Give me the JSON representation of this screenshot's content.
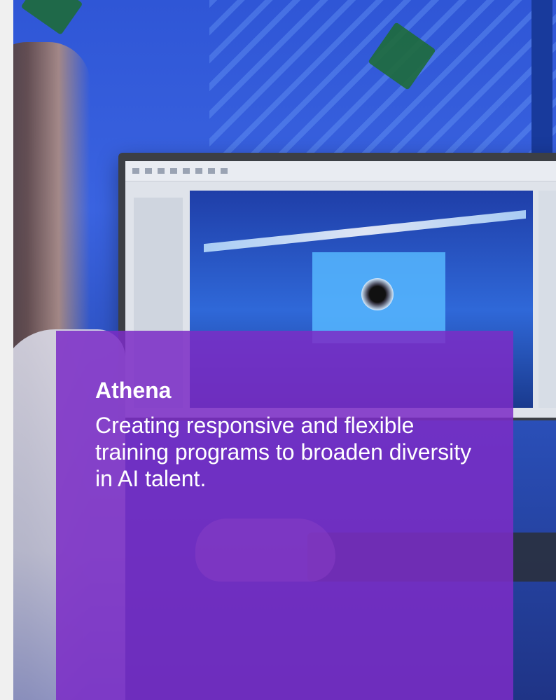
{
  "card": {
    "title": "Athena",
    "description": "Creating responsive and flexible training programs to broaden diversity in AI talent."
  },
  "colors": {
    "card_background": "#7C2CC6",
    "card_text": "#FFFFFF",
    "photo_blue": "#2F56D6"
  }
}
